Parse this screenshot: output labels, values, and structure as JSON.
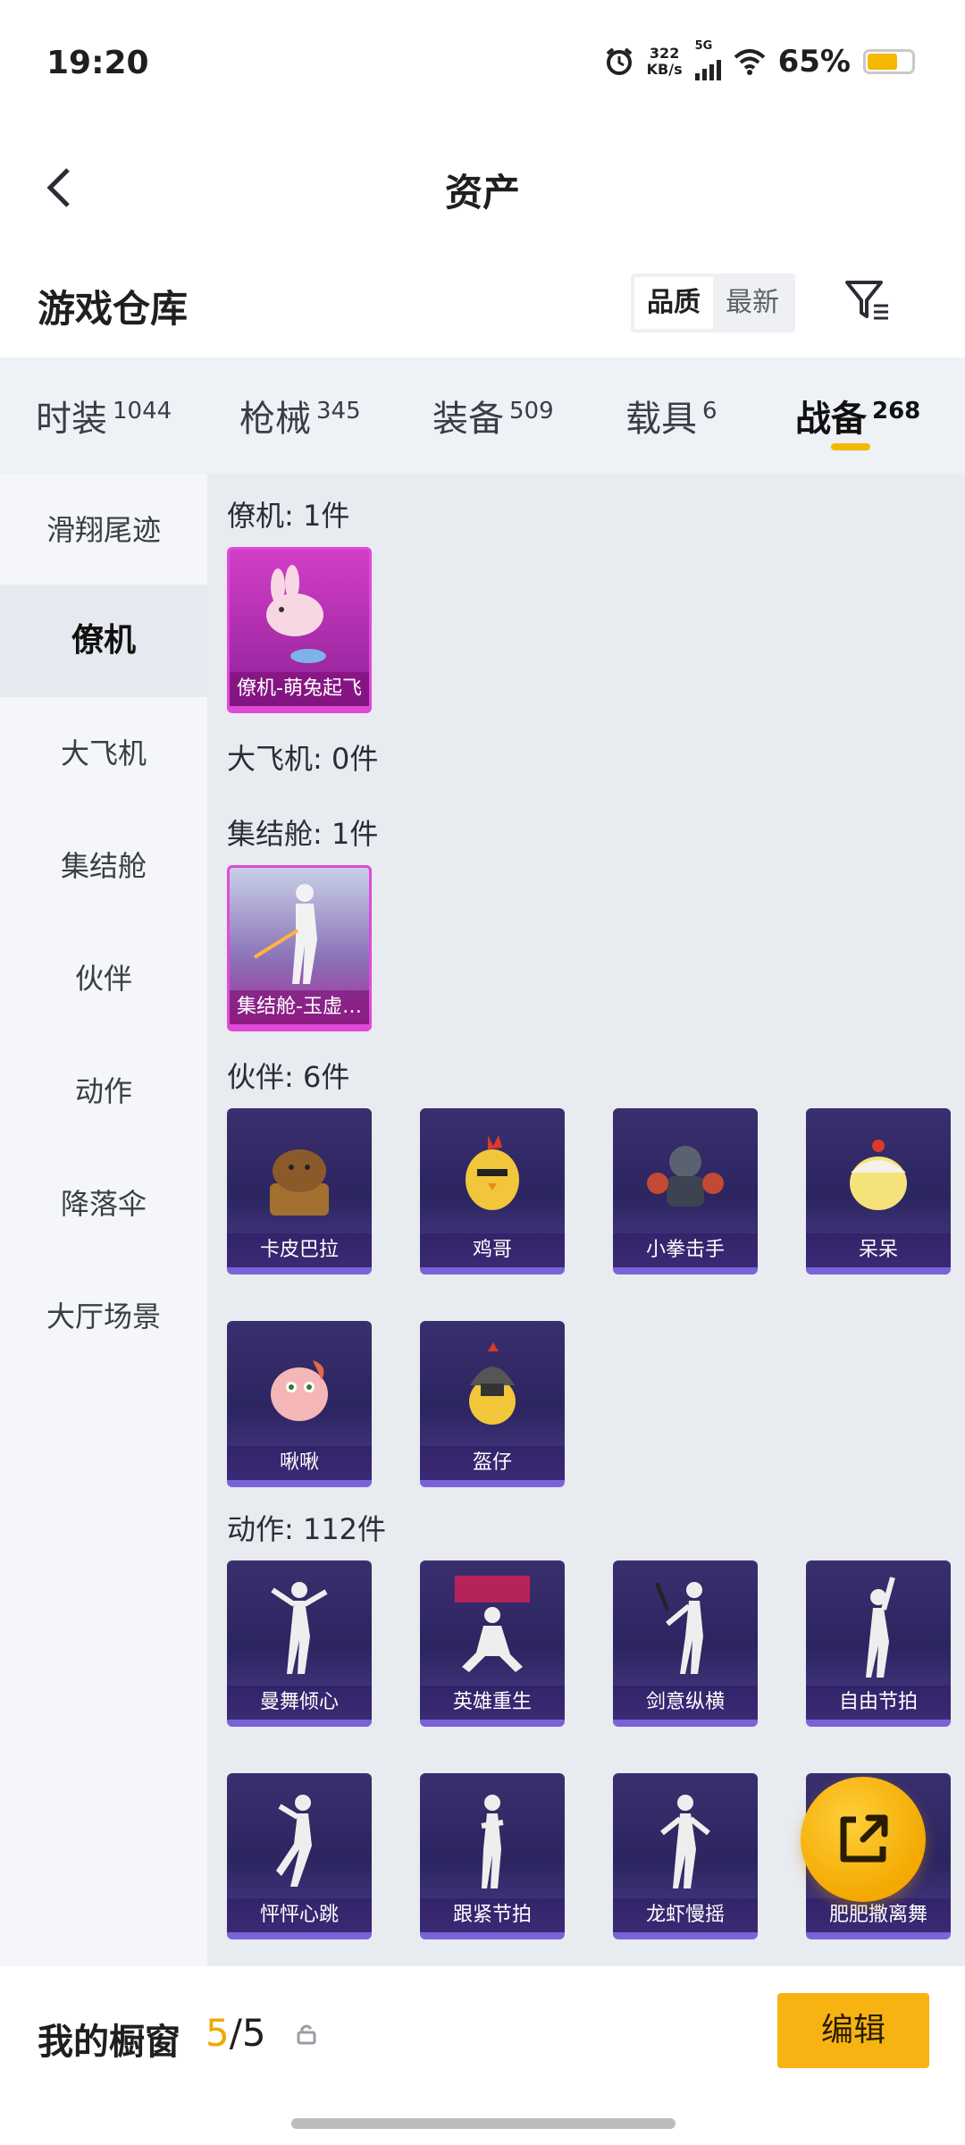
{
  "status": {
    "time": "19:20",
    "net_speed": "322",
    "net_unit": "KB/s",
    "network": "5G",
    "battery": "65%",
    "battery_level": 0.65
  },
  "header": {
    "title": "资产",
    "back_icon": "chevron-left-icon"
  },
  "warehouse": {
    "title": "游戏仓库",
    "sort_options": [
      "品质",
      "最新"
    ],
    "filter_icon": "filter-icon"
  },
  "tabs": [
    {
      "label": "时装",
      "count": "1044"
    },
    {
      "label": "枪械",
      "count": "345"
    },
    {
      "label": "装备",
      "count": "509"
    },
    {
      "label": "载具",
      "count": "6"
    },
    {
      "label": "战备",
      "count": "268"
    }
  ],
  "sidebar": [
    "滑翔尾迹",
    "僚机",
    "大飞机",
    "集结舱",
    "伙伴",
    "动作",
    "降落伞",
    "大厅场景"
  ],
  "sections": [
    {
      "title": "僚机: 1件",
      "items": [
        "僚机-萌兔起飞"
      ]
    },
    {
      "title": "大飞机: 0件",
      "items": []
    },
    {
      "title": "集结舱: 1件",
      "items": [
        "集结舱-玉虚…"
      ]
    },
    {
      "title": "伙伴: 6件",
      "items": [
        "卡皮巴拉",
        "鸡哥",
        "小拳击手",
        "呆呆",
        "啾啾",
        "盔仔"
      ]
    },
    {
      "title": "动作: 112件",
      "items": [
        "曼舞倾心",
        "英雄重生",
        "剑意纵横",
        "自由节拍",
        "怦怦心跳",
        "跟紧节拍",
        "龙虾慢摇",
        "肥肥撒离舞"
      ]
    }
  ],
  "bottom": {
    "title": "我的橱窗",
    "current": "5",
    "sep": "/",
    "total": "5",
    "edit": "编辑"
  }
}
